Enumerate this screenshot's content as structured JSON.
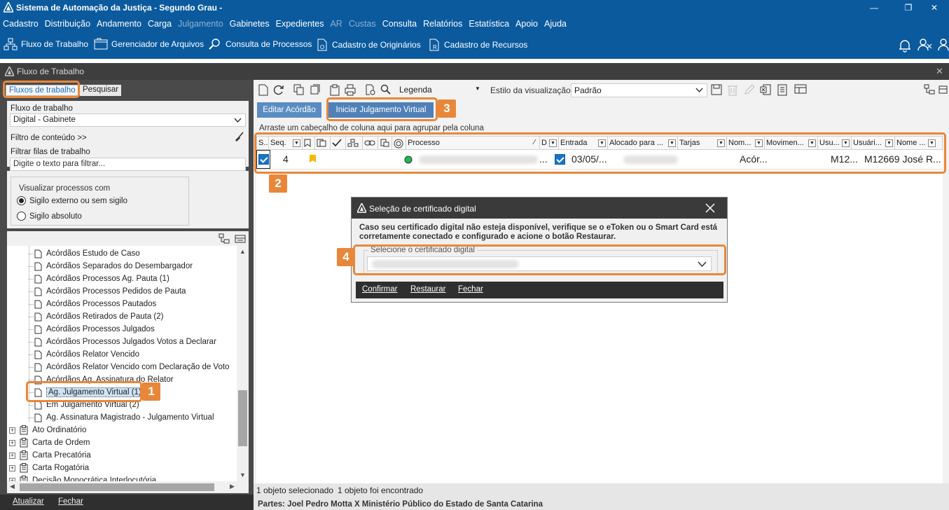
{
  "window": {
    "title": "Sistema de Automação da Justiça - Segundo Grau -",
    "minimize_label": "—",
    "restore_label": "❐",
    "close_label": "✕"
  },
  "menu": {
    "items": [
      {
        "label": "Cadastro",
        "enabled": true
      },
      {
        "label": "Distribuição",
        "enabled": true
      },
      {
        "label": "Andamento",
        "enabled": true
      },
      {
        "label": "Carga",
        "enabled": true
      },
      {
        "label": "Julgamento",
        "enabled": false
      },
      {
        "label": "Gabinetes",
        "enabled": true
      },
      {
        "label": "Expedientes",
        "enabled": true
      },
      {
        "label": "AR",
        "enabled": false
      },
      {
        "label": "Custas",
        "enabled": false
      },
      {
        "label": "Consulta",
        "enabled": true
      },
      {
        "label": "Relatórios",
        "enabled": true
      },
      {
        "label": "Estatística",
        "enabled": true
      },
      {
        "label": "Apoio",
        "enabled": true
      },
      {
        "label": "Ajuda",
        "enabled": true
      }
    ]
  },
  "toolbar": {
    "fluxo": "Fluxo de Trabalho",
    "gerenciador": "Gerenciador de Arquivos",
    "consulta": "Consulta de Processos",
    "originarios": "Cadastro de Originários",
    "recursos": "Cadastro de Recursos"
  },
  "panel": {
    "title": "Fluxo de Trabalho",
    "close_label": "✕"
  },
  "left": {
    "tab_fluxos": "Fluxos de trabalho",
    "tab_pesquisar": "Pesquisar",
    "fluxo_label": "Fluxo de trabalho",
    "fluxo_value": "Digital - Gabinete",
    "filtro_conteudo": "Filtro de conteúdo >>",
    "filtrar_label": "Filtrar filas de trabalho",
    "filtrar_placeholder": "Digite o texto para filtrar...",
    "visualizar_label": "Visualizar processos com",
    "radio1": "Sigilo externo ou sem sigilo",
    "radio2": "Sigilo absoluto",
    "atualizar": "Atualizar",
    "fechar": "Fechar"
  },
  "tree": {
    "children": [
      "Acórdãos Estudo de Caso",
      "Acórdãos Separados do Desembargador",
      "Acórdãos Processos Ag. Pauta (1)",
      "Acórdãos Processos Pedidos de Pauta",
      "Acórdãos Processos Pautados",
      "Acórdãos Retirados de Pauta (2)",
      "Acórdãos Processos Julgados",
      "Acórdãos Processos Julgados Votos a Declarar",
      "Acórdãos Relator Vencido",
      "Acórdãos Relator Vencido com Declaração de Voto",
      "Acórdãos Ag. Assinatura do Relator",
      "Ag. Julgamento Virtual (1)",
      "Em Julgamento Virtual (2)",
      "Ag. Assinatura Magistrado - Julgamento Virtual"
    ],
    "groups": [
      "Ato Ordinatório",
      "Carta de Ordem",
      "Carta Precatória",
      "Carta Rogatória",
      "Decisão Monocrática Interlocutória"
    ],
    "expand_symbol": "+"
  },
  "right": {
    "legenda": "Legenda",
    "estilo_label": "Estilo da visualização",
    "estilo_value": "Padrão",
    "btn_editar": "Editar Acórdão",
    "btn_iniciar": "Iniciar Julgamento Virtual",
    "group_hint": "Arraste um cabeçalho de coluna aqui para agrupar pela coluna",
    "columns": {
      "s": "S...",
      "seq": "Seq.",
      "processo": "Processo",
      "d": "D",
      "entrada": "Entrada",
      "alocado": "Alocado para ...",
      "tarjas": "Tarjas",
      "nom": "Nom...",
      "movimen": "Movimen...",
      "usu": "Usu...",
      "usuari": "Usuári...",
      "nome": "Nome ..."
    },
    "row": {
      "seq": "4",
      "processo_tail": "...",
      "entrada": "03/05/...",
      "nom": "Acór...",
      "usu": "M12...",
      "usuari": "M12669 José R..."
    },
    "status1": "1 objeto selecionado",
    "status2": "1 objeto foi encontrado",
    "partes": "Partes: Joel Pedro Motta  X  Ministério Público do Estado de Santa Catarina"
  },
  "dialog": {
    "title": "Seleção de certificado digital",
    "message_line1": "Caso seu certificado digital não esteja disponível, verifique se o eToken ou o Smart Card está",
    "message_line2": "corretamente conectado e configurado e acione o botão Restaurar.",
    "select_label": "Selecione o certificado digital",
    "confirmar": "Confirmar",
    "restaurar": "Restaurar",
    "fechar": "Fechar"
  },
  "callouts": {
    "n1": "1",
    "n2": "2",
    "n3": "3",
    "n4": "4"
  },
  "colors": {
    "app_blue": "#0b5a9e",
    "callout_orange": "#e8873a",
    "action_button": "#5a8cc2",
    "selection_highlight": "#cde3f7",
    "checkbox_blue": "#1a73c9"
  }
}
